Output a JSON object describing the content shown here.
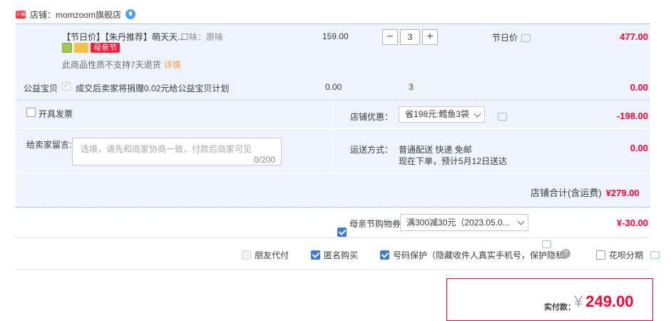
{
  "shop": {
    "tag": "天猫",
    "name": "店铺：momzoom旗舰店"
  },
  "item": {
    "title": "【节日价】【朱丹推荐】萌天天...",
    "sku": "口味：原味",
    "badge_mother": "母亲节",
    "no_return": "此商品性质不支持7天退货",
    "detail_link": "详情",
    "price": "159.00",
    "qty_minus": "−",
    "qty": "3",
    "qty_plus": "+",
    "promo": "节日价",
    "subtotal": "477.00"
  },
  "charity": {
    "label": "公益宝贝",
    "check": "✓",
    "text": "成交后卖家将捐赠0.02元给公益宝贝计划",
    "price": "0.00",
    "qty": "3",
    "subtotal": "0.00"
  },
  "invoice": {
    "label": "开具发票"
  },
  "message": {
    "label": "给卖家留言:",
    "placeholder": "选填，请先和商家协商一致，付款后商家可见",
    "count": "0/200"
  },
  "store_discount": {
    "label": "店铺优惠：",
    "value": "省198元:鳕鱼3袋",
    "amount": "-198.00"
  },
  "shipping": {
    "label": "运送方式：",
    "method": "普通配送 快递 免邮",
    "eta": "现在下单，预计5月12日送达",
    "amount": "0.00"
  },
  "store_total": {
    "label": "店铺合计(含运费)",
    "value": "¥279.00"
  },
  "coupon": {
    "label": "母亲节购物券",
    "value": "满300减30元（2023.05.0...",
    "amount": "¥-30.00"
  },
  "options": {
    "friend_pay": "朋友代付",
    "anon_buy": "匿名购买",
    "number_protect": "号码保护（隐藏收件人真实手机号，保护隐私）",
    "help": "?",
    "huabei": "花呗分期"
  },
  "payment": {
    "label": "实付款：",
    "currency": "¥",
    "amount": "249.00"
  }
}
